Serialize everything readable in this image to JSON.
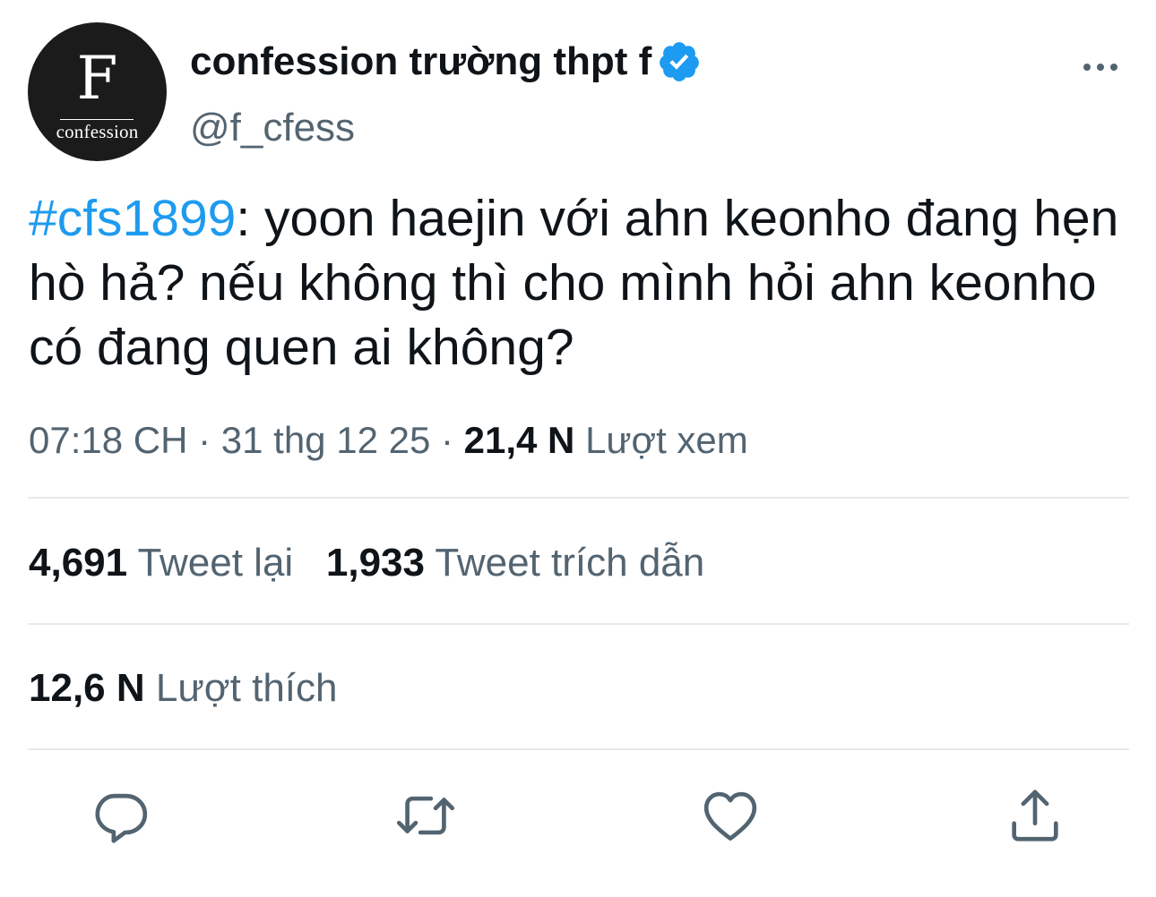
{
  "account": {
    "avatar_letter": "F",
    "avatar_word": "confession",
    "display_name": "confession trường thpt f",
    "handle": "@f_cfess",
    "verified": true
  },
  "tweet": {
    "hashtag": "#cfs1899",
    "body": ": yoon haejin với ahn keonho đang hẹn hò hả? nếu không thì cho mình hỏi ahn keonho có đang quen ai không?"
  },
  "meta": {
    "time": "07:18 CH",
    "separator": " · ",
    "date": "31 thg 12 25",
    "views_count": "21,4 N",
    "views_label": "Lượt xem"
  },
  "stats": {
    "retweets_count": "4,691",
    "retweets_label": "Tweet lại",
    "quotes_count": "1,933",
    "quotes_label": "Tweet trích dẫn",
    "likes_count": "12,6 N",
    "likes_label": "Lượt thích"
  },
  "icons": {
    "verified_badge": "verified-badge-icon",
    "more": "more-icon",
    "reply": "reply-icon",
    "retweet": "retweet-icon",
    "like": "heart-icon",
    "share": "share-icon"
  },
  "colors": {
    "accent": "#1d9bf0",
    "text": "#0f1419",
    "secondary": "#536471",
    "divider": "#e7e9ea",
    "avatar_bg": "#1b1b1b"
  }
}
